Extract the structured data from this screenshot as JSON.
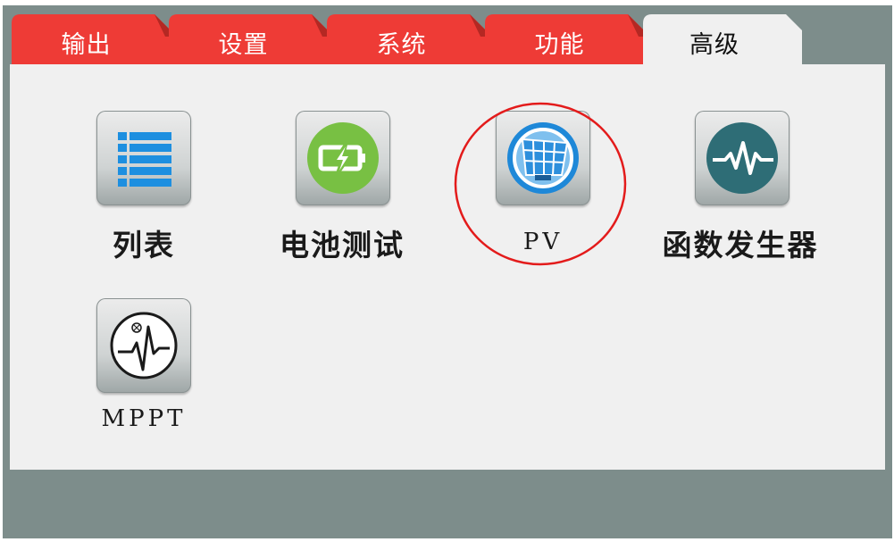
{
  "tabs": [
    {
      "label": "输出",
      "active": false
    },
    {
      "label": "设置",
      "active": false
    },
    {
      "label": "系统",
      "active": false
    },
    {
      "label": "功能",
      "active": false
    },
    {
      "label": "高级",
      "active": true
    }
  ],
  "apps": [
    {
      "label": "列表",
      "icon": "list-icon"
    },
    {
      "label": "电池测试",
      "icon": "battery-charging-icon"
    },
    {
      "label": "PV",
      "icon": "solar-panel-icon",
      "highlighted": true
    },
    {
      "label": "函数发生器",
      "icon": "waveform-icon"
    },
    {
      "label": "MPPT",
      "icon": "mppt-icon"
    }
  ],
  "colors": {
    "tab_inactive": "#ee3b36",
    "tab_active": "#f0f0f0",
    "frame": "#7d8d8b",
    "panel": "#f0f0f0",
    "highlight": "#e31b1b",
    "list_icon_blue": "#1d8fe0",
    "battery_green": "#78c043",
    "pv_blue": "#1e88d8",
    "wave_teal": "#2e6d76"
  }
}
